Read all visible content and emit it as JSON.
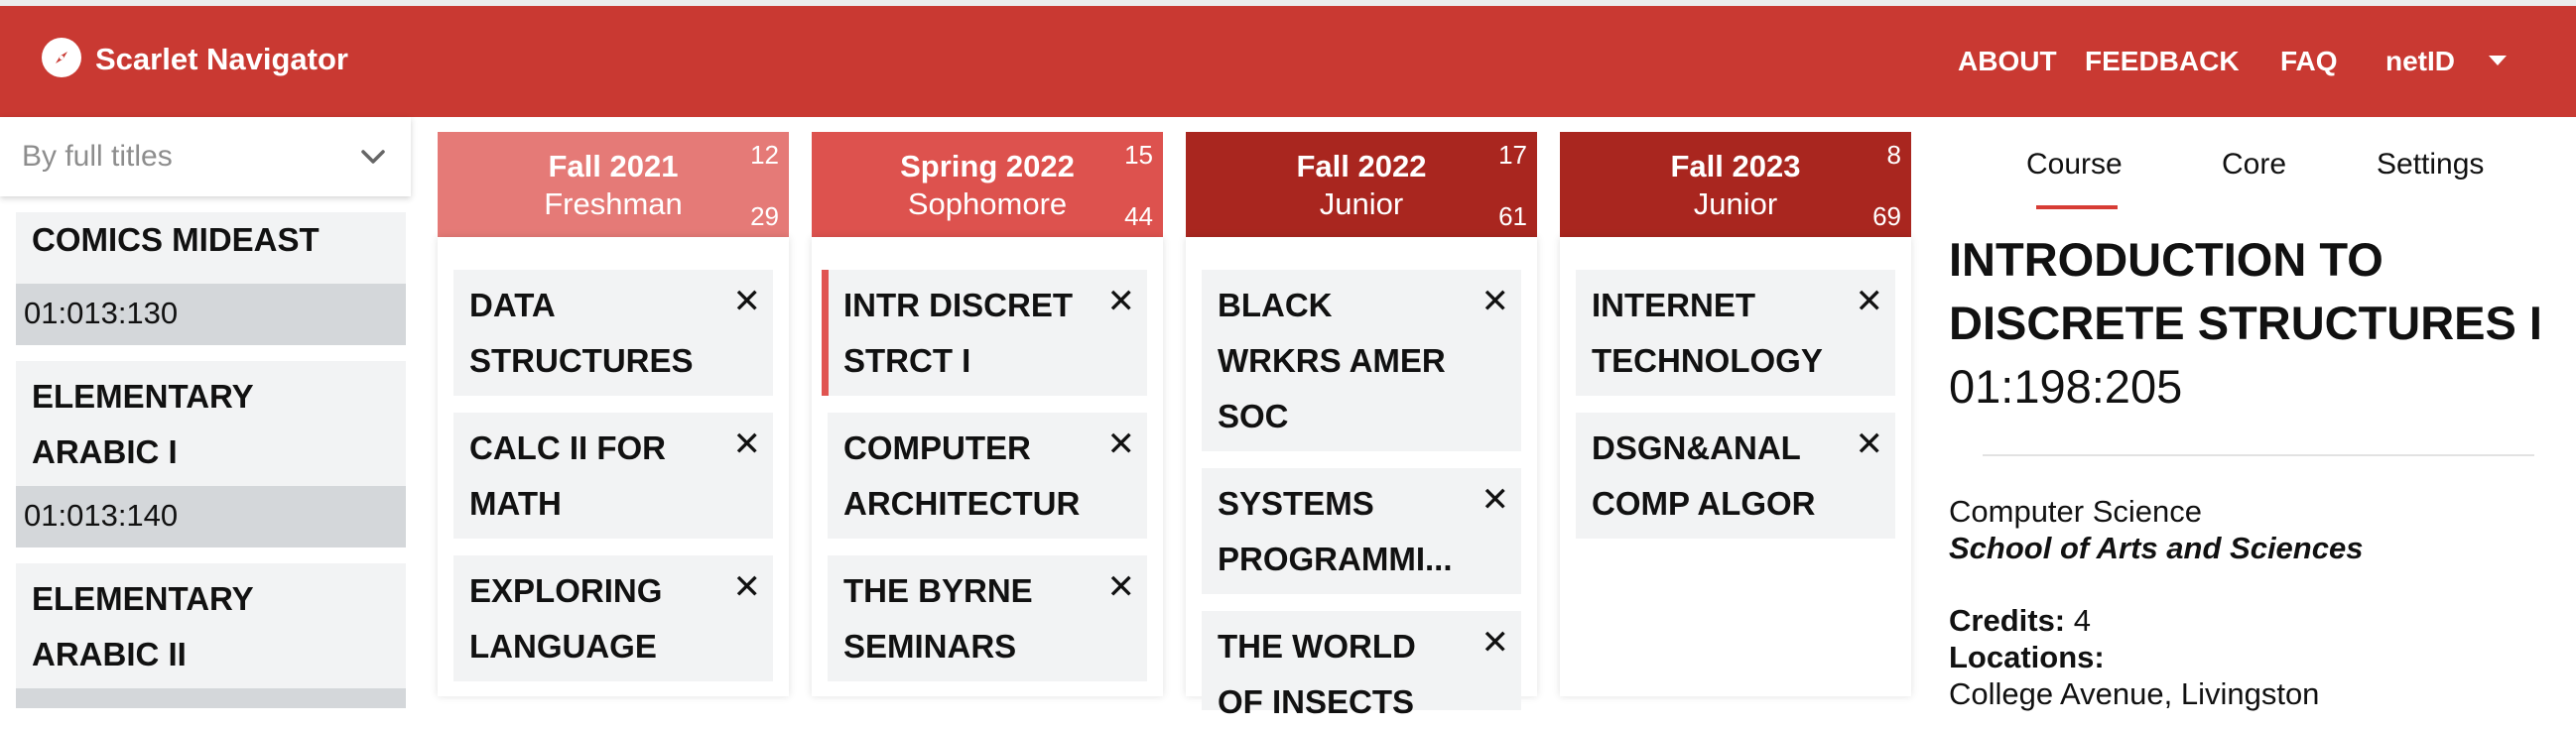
{
  "header": {
    "brand": "Scarlet Navigator",
    "nav": {
      "about": "ABOUT",
      "feedback": "FEEDBACK",
      "faq": "FAQ",
      "user": "netID"
    }
  },
  "sidebar": {
    "search_mode": "By full titles",
    "items": [
      {
        "title_lines": [
          "COMICS MIDEAST"
        ],
        "code": "01:013:130"
      },
      {
        "title_lines": [
          "ELEMENTARY",
          "ARABIC I"
        ],
        "code": "01:013:140"
      },
      {
        "title_lines": [
          "ELEMENTARY",
          "ARABIC II"
        ],
        "code": ""
      }
    ]
  },
  "semesters": [
    {
      "name": "Fall 2021",
      "year": "Freshman",
      "credits": "12",
      "cumulative": "29",
      "color": "#e57a77",
      "courses": [
        [
          "DATA",
          "STRUCTURES"
        ],
        [
          "CALC II FOR",
          "MATH"
        ],
        [
          "EXPLORING",
          "LANGUAGE"
        ]
      ]
    },
    {
      "name": "Spring 2022",
      "year": "Sophomore",
      "credits": "15",
      "cumulative": "44",
      "color": "#dd524e",
      "courses": [
        [
          "INTR DISCRET",
          "STRCT I"
        ],
        [
          "COMPUTER",
          "ARCHITECTUR"
        ],
        [
          "THE BYRNE",
          "SEMINARS"
        ]
      ]
    },
    {
      "name": "Fall 2022",
      "year": "Junior",
      "credits": "17",
      "cumulative": "61",
      "color": "#a9261f",
      "courses": [
        [
          "BLACK",
          "WRKRS AMER",
          "SOC"
        ],
        [
          "SYSTEMS",
          "PROGRAMMI..."
        ],
        [
          "THE WORLD",
          "OF INSECTS"
        ]
      ]
    },
    {
      "name": "Fall 2023",
      "year": "Junior",
      "credits": "8",
      "cumulative": "69",
      "color": "#a9261f",
      "courses": [
        [
          "INTERNET",
          "TECHNOLOGY"
        ],
        [
          "DSGN&ANAL",
          "COMP ALGOR"
        ]
      ]
    }
  ],
  "course_remove_glyph": "✕",
  "details": {
    "tabs": [
      "Course",
      "Core",
      "Settings"
    ],
    "active_tab": "Course",
    "title_lines": [
      "INTRODUCTION TO",
      "DISCRETE STRUCTURES I"
    ],
    "code": "01:198:205",
    "department": "Computer Science",
    "school": "School of Arts and Sciences",
    "credits_label": "Credits:",
    "credits_value": "4",
    "locations_label": "Locations:",
    "locations_value": "College Avenue, Livingston"
  }
}
